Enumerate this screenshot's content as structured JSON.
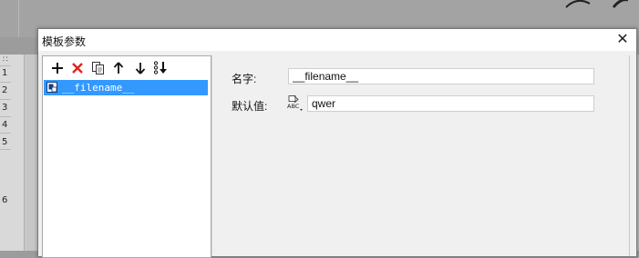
{
  "background": {
    "row_numbers": [
      "1",
      "2",
      "3",
      "4",
      "5",
      "6"
    ],
    "grip_glyph": "∷"
  },
  "dialog": {
    "title": "模板参数",
    "close_glyph": "✕"
  },
  "toolbar": {
    "buttons": [
      {
        "name": "add-icon"
      },
      {
        "name": "delete-icon"
      },
      {
        "name": "copy-icon"
      },
      {
        "name": "move-up-icon"
      },
      {
        "name": "move-down-icon"
      },
      {
        "name": "move-bottom-icon"
      }
    ],
    "colors": {
      "delete": "#e0231f",
      "dark": "#111111"
    }
  },
  "tree": {
    "items": [
      {
        "label": "__filename__",
        "selected": true
      }
    ],
    "selected_color": "#3399ff"
  },
  "form": {
    "name_label": "名字:",
    "name_value": "__filename__",
    "default_label": "默认值:",
    "default_value": "qwer",
    "type_icon_text": "ABC"
  }
}
